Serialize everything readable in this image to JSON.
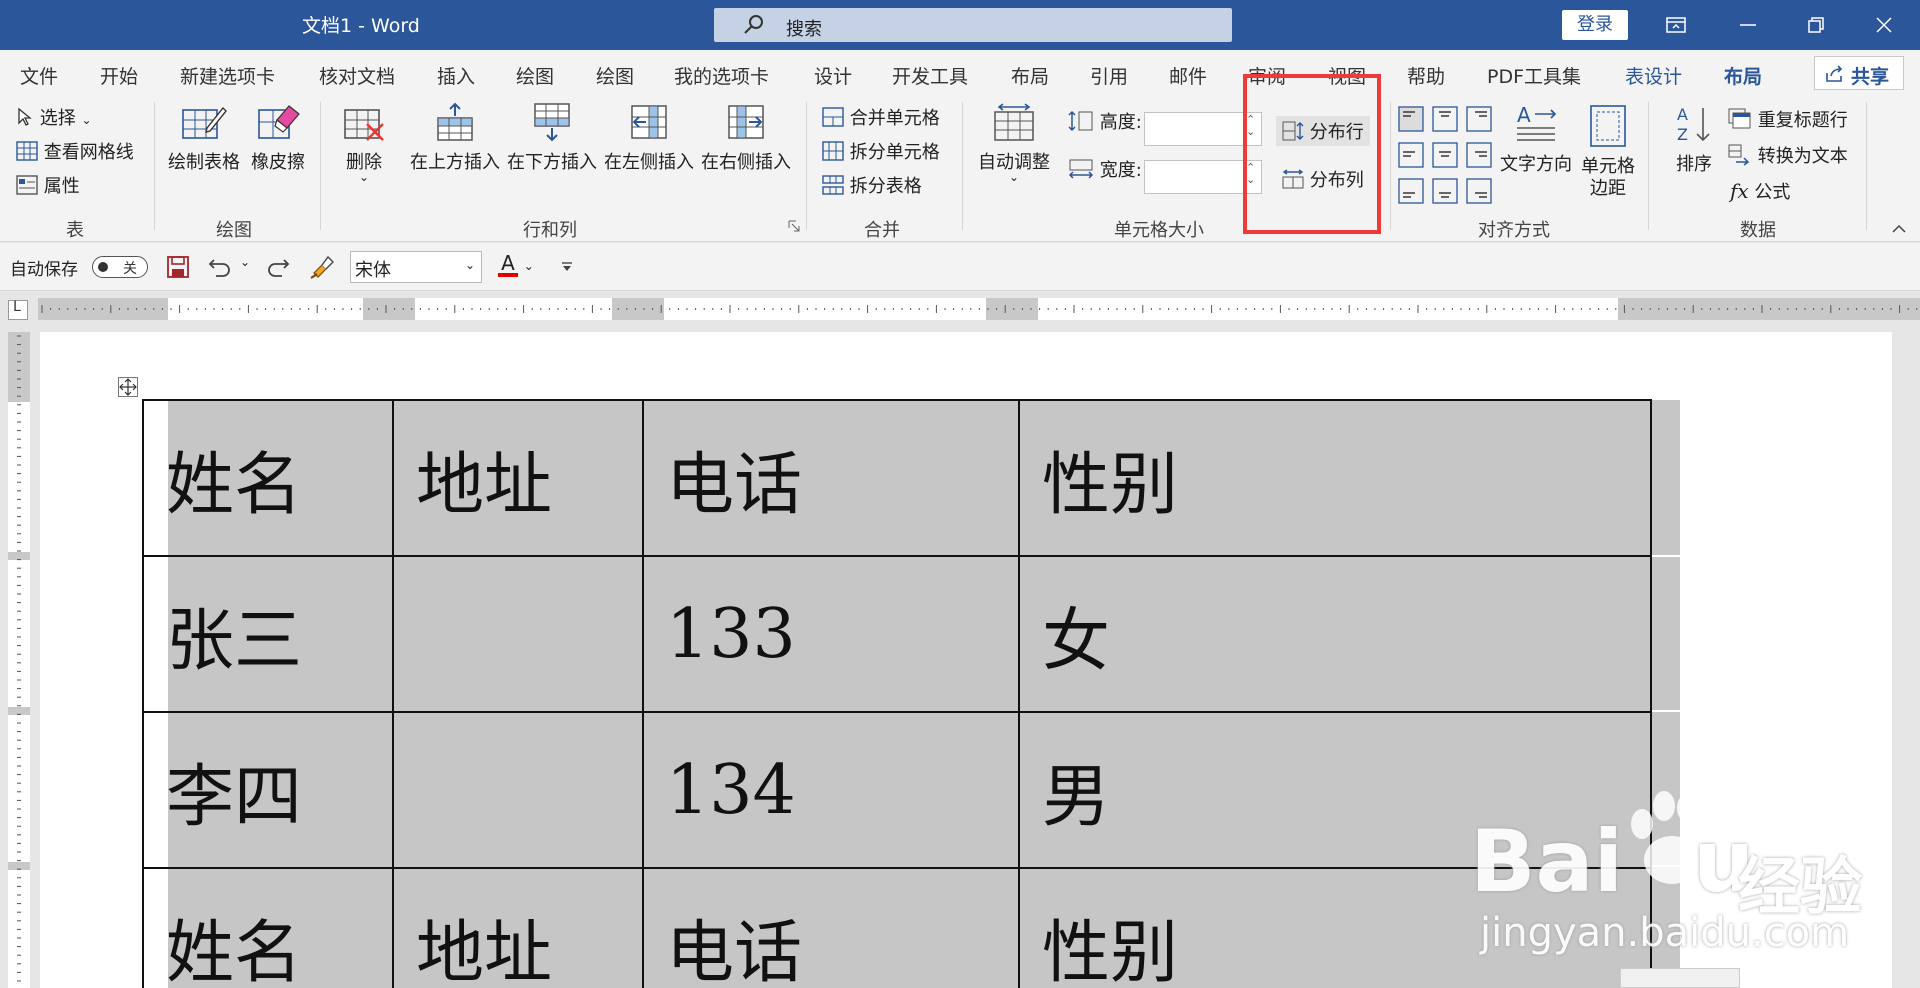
{
  "window": {
    "title": "文档1  -  Word"
  },
  "search": {
    "label": "搜索"
  },
  "login": {
    "label": "登录"
  },
  "tabs": [
    "文件",
    "开始",
    "新建选项卡",
    "核对文档",
    "插入",
    "绘图",
    "绘图",
    "我的选项卡",
    "设计",
    "开发工具",
    "布局",
    "引用",
    "邮件",
    "审阅",
    "视图",
    "帮助",
    "PDF工具集",
    "表设计",
    "布局"
  ],
  "share": {
    "label": "共享"
  },
  "ribbon": {
    "table_group": {
      "select": "选择",
      "gridlines": "查看网格线",
      "properties": "属性",
      "label": "表"
    },
    "draw_group": {
      "draw_table": "绘制表格",
      "eraser": "橡皮擦",
      "label": "绘图"
    },
    "rowscols_group": {
      "delete": "删除",
      "insert_above": "在上方插入",
      "insert_below": "在下方插入",
      "insert_left": "在左侧插入",
      "insert_right": "在右侧插入",
      "label": "行和列"
    },
    "merge_group": {
      "merge_cells": "合并单元格",
      "split_cells": "拆分单元格",
      "split_table": "拆分表格",
      "label": "合并"
    },
    "cellsize_group": {
      "autofit": "自动调整",
      "height": "高度:",
      "width": "宽度:",
      "distribute_rows": "分布行",
      "distribute_cols": "分布列",
      "label": "单元格大小"
    },
    "align_group": {
      "text_direction": "文字方向",
      "cell_margins_1": "单元格",
      "cell_margins_2": "边距",
      "label": "对齐方式"
    },
    "data_group": {
      "sort": "排序",
      "repeat_header": "重复标题行",
      "convert_text": "转换为文本",
      "formula": "公式",
      "label": "数据"
    }
  },
  "qat": {
    "autosave": "自动保存",
    "toggle": "关",
    "font": "宋体"
  },
  "table": {
    "rows": [
      [
        "姓名",
        "地址",
        "电话",
        "性别"
      ],
      [
        "张三",
        "",
        "133",
        "女"
      ],
      [
        "李四",
        "",
        "134",
        "男"
      ],
      [
        "姓名",
        "地址",
        "电话",
        "性别"
      ]
    ]
  },
  "watermark": {
    "brand": "Bai",
    "brand2": "u",
    "cn": "经验",
    "url": "jingyan.baidu.com"
  },
  "colors": {
    "accent": "#2b579a",
    "highlight": "#ee3a3a",
    "cell_bg": "#c6c6c6"
  }
}
